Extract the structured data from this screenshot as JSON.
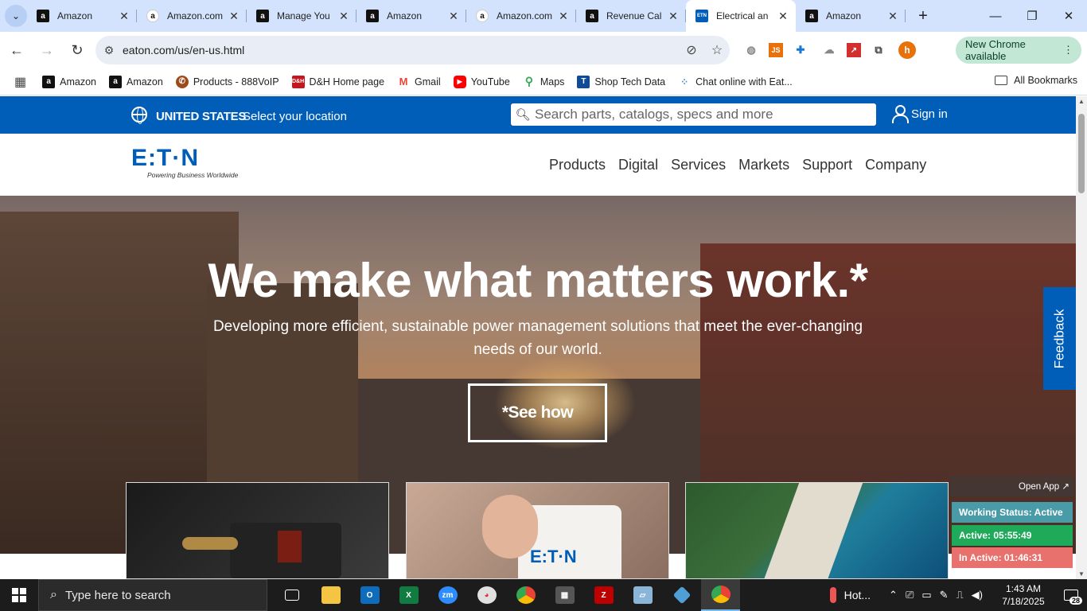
{
  "browser": {
    "tabs": [
      {
        "title": "Amazon",
        "icon": "amazon-a",
        "active": false
      },
      {
        "title": "Amazon.com",
        "icon": "amazon-smile",
        "active": false
      },
      {
        "title": "Manage You",
        "icon": "amazon-a",
        "active": false
      },
      {
        "title": "Amazon",
        "icon": "amazon-a",
        "active": false
      },
      {
        "title": "Amazon.com",
        "icon": "amazon-smile",
        "active": false
      },
      {
        "title": "Revenue Cal",
        "icon": "amazon-a",
        "active": false
      },
      {
        "title": "Electrical an",
        "icon": "eaton",
        "active": true
      },
      {
        "title": "Amazon",
        "icon": "amazon-a",
        "active": false
      }
    ],
    "url": "eaton.com/us/en-us.html",
    "new_chrome_label": "New Chrome available",
    "profile_initial": "h",
    "bookmarks": [
      {
        "label": "Amazon",
        "color": "#111111"
      },
      {
        "label": "Amazon",
        "color": "#111111"
      },
      {
        "label": "Products - 888VoIP",
        "color": "#9c4a1a"
      },
      {
        "label": "D&H Home page",
        "color": "#c4161c"
      },
      {
        "label": "Gmail",
        "color": "#ea4335"
      },
      {
        "label": "YouTube",
        "color": "#ff0000"
      },
      {
        "label": "Maps",
        "color": "#34a853"
      },
      {
        "label": "Shop Tech Data",
        "color": "#0e4c9a"
      },
      {
        "label": "Chat online with Eat...",
        "color": "#3f8fd2"
      }
    ],
    "all_bookmarks": "All Bookmarks"
  },
  "site": {
    "country": "UNITED STATES",
    "select_location": "Select your location",
    "search_placeholder": "Search parts, catalogs, specs and more",
    "sign_in": "Sign in",
    "logo_text": "E:T·N",
    "logo_tagline": "Powering Business Worldwide",
    "nav": [
      "Products",
      "Digital",
      "Services",
      "Markets",
      "Support",
      "Company"
    ],
    "hero_title": "We make what matters work.*",
    "hero_subtitle": "Developing more efficient, sustainable power management solutions that meet the ever-changing needs of our world.",
    "hero_cta": "*See how",
    "feedback": "Feedback",
    "mug_text": "E:T·N",
    "brand_color": "#005eb8"
  },
  "status_widget": {
    "open_app": "Open App ↗",
    "working_status": "Working Status: Active",
    "active": "Active: 05:55:49",
    "inactive": "In Active: 01:46:31"
  },
  "taskbar": {
    "search_placeholder": "Type here to search",
    "weather": "Hot...",
    "time": "1:43 AM",
    "date": "7/18/2025",
    "notifications": "28"
  }
}
